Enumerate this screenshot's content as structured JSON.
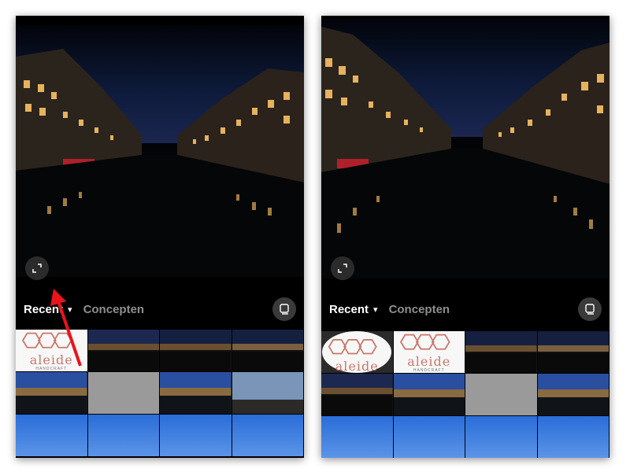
{
  "panels": [
    {
      "id": "left",
      "tabs": {
        "recent": "Recent",
        "concepts": "Concepten"
      },
      "chevron": "▾",
      "logo_tiles": [
        {
          "word": "aleide",
          "sub": "HANDCRAFT"
        }
      ],
      "has_arrow": true
    },
    {
      "id": "right",
      "tabs": {
        "recent": "Recent",
        "concepts": "Concepten"
      },
      "chevron": "▾",
      "logo_tiles": [
        {
          "word": "aleide",
          "sub": ""
        },
        {
          "word": "aleide",
          "sub": "HANDCRAFT"
        }
      ],
      "has_arrow": false
    }
  ],
  "icons": {
    "expand": "expand-icon",
    "multi_select": "multi-select-icon",
    "chevron": "chevron-down-icon",
    "arrow": "red-arrow-annotation"
  },
  "colors": {
    "arrow": "#e8141c",
    "logo": "#c9786a",
    "inactive_tab": "#8e8e8e"
  }
}
